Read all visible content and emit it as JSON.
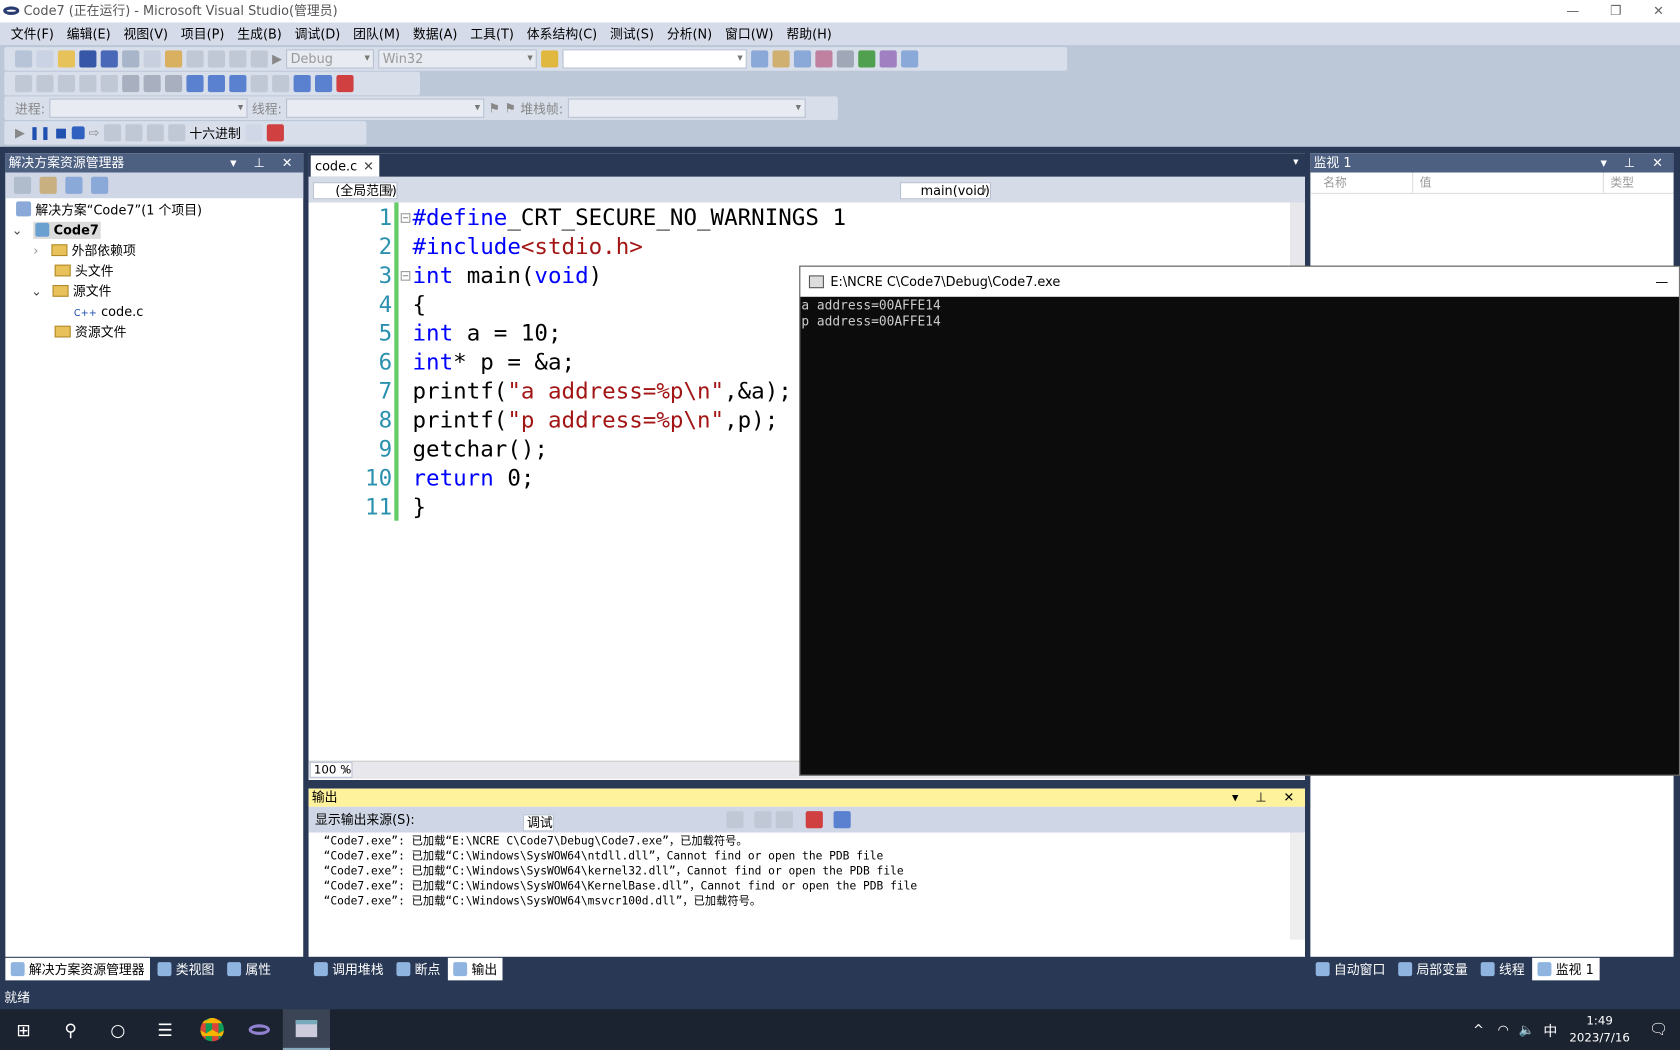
{
  "window": {
    "title": "Code7 (正在运行) - Microsoft Visual Studio(管理员)",
    "minimize": "—",
    "restore": "❐",
    "close": "✕"
  },
  "menu": [
    "文件(F)",
    "编辑(E)",
    "视图(V)",
    "项目(P)",
    "生成(B)",
    "调试(D)",
    "团队(M)",
    "数据(A)",
    "工具(T)",
    "体系结构(C)",
    "测试(S)",
    "分析(N)",
    "窗口(W)",
    "帮助(H)"
  ],
  "toolbar": {
    "config": "Debug",
    "platform": "Win32",
    "find_value": "",
    "process_label": "进程:",
    "thread_label": "线程:",
    "stackframe_label": "堆栈帧:",
    "hex_label": "十六进制"
  },
  "solution_explorer": {
    "title": "解决方案资源管理器",
    "items": [
      {
        "label": "解决方案“Code7”(1 个项目)"
      },
      {
        "label": "Code7"
      },
      {
        "label": "外部依赖项"
      },
      {
        "label": "头文件"
      },
      {
        "label": "源文件"
      },
      {
        "label": "code.c"
      },
      {
        "label": "资源文件"
      }
    ]
  },
  "editor": {
    "tab": "code.c",
    "scope": "(全局范围)",
    "function": "main(void)",
    "zoom": "100 %",
    "lines": [
      [
        [
          "pp",
          "#define"
        ],
        [
          "",
          "_CRT_SECURE_NO_WARNINGS 1"
        ]
      ],
      [
        [
          "pp",
          "#include"
        ],
        [
          "str",
          "<stdio.h>"
        ]
      ],
      [
        [
          "kw",
          "int"
        ],
        [
          "",
          " main("
        ],
        [
          "kw",
          "void"
        ],
        [
          "",
          ")"
        ]
      ],
      [
        [
          "",
          "{"
        ]
      ],
      [
        [
          "kw",
          "int"
        ],
        [
          "",
          " a = 10;"
        ]
      ],
      [
        [
          "kw",
          "int"
        ],
        [
          "",
          "* p = &a;"
        ]
      ],
      [
        [
          "",
          "printf("
        ],
        [
          "str",
          "\"a address=%p\\n\""
        ],
        [
          "",
          ",&a);"
        ]
      ],
      [
        [
          "",
          "printf("
        ],
        [
          "str",
          "\"p address=%p\\n\""
        ],
        [
          "",
          ",p);"
        ]
      ],
      [
        [
          "",
          "getchar();"
        ]
      ],
      [
        [
          "kw",
          "return"
        ],
        [
          "",
          " 0;"
        ]
      ],
      [
        [
          "",
          "}"
        ]
      ]
    ]
  },
  "console": {
    "title": "E:\\NCRE C\\Code7\\Debug\\Code7.exe",
    "lines": [
      "a address=00AFFE14",
      "p address=00AFFE14"
    ]
  },
  "output": {
    "title": "输出",
    "source_label": "显示输出来源(S):",
    "source_value": "调试",
    "lines": [
      "“Code7.exe”: 已加载“E:\\NCRE C\\Code7\\Debug\\Code7.exe”，已加载符号。",
      "“Code7.exe”: 已加载“C:\\Windows\\SysWOW64\\ntdll.dll”，Cannot find or open the PDB file",
      "“Code7.exe”: 已加载“C:\\Windows\\SysWOW64\\kernel32.dll”，Cannot find or open the PDB file",
      "“Code7.exe”: 已加载“C:\\Windows\\SysWOW64\\KernelBase.dll”，Cannot find or open the PDB file",
      "“Code7.exe”: 已加载“C:\\Windows\\SysWOW64\\msvcr100d.dll”，已加载符号。"
    ]
  },
  "watch": {
    "title": "监视 1",
    "columns": [
      "名称",
      "值",
      "类型"
    ]
  },
  "bottom_tabs_left": [
    {
      "label": "解决方案资源管理器",
      "active": true
    },
    {
      "label": "类视图"
    },
    {
      "label": "属性"
    }
  ],
  "bottom_tabs_mid": [
    {
      "label": "调用堆栈"
    },
    {
      "label": "断点"
    },
    {
      "label": "输出",
      "active": true
    }
  ],
  "bottom_tabs_right": [
    {
      "label": "自动窗口"
    },
    {
      "label": "局部变量"
    },
    {
      "label": "线程"
    },
    {
      "label": "监视 1",
      "active": true
    }
  ],
  "status": "就绪",
  "taskbar": {
    "time": "1:49",
    "date": "2023/7/16",
    "ime": "中"
  },
  "colors": {
    "accent": "#293955",
    "panel_header": "#4d6082",
    "output_header": "#fff29d",
    "keyword": "#0000ff",
    "string": "#a31515",
    "line_number": "#2b91af"
  }
}
